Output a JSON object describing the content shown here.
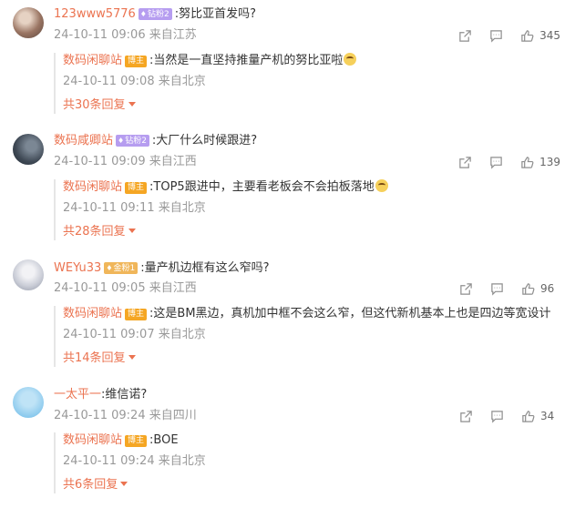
{
  "icons": {
    "share": "share-icon",
    "comment": "comment-icon",
    "like": "thumbs-up-icon"
  },
  "colors": {
    "username": "#eb7350",
    "meta": "#999999",
    "badge_purple": "#b69df0",
    "badge_gold": "#f0b65a",
    "author": "#f5a623"
  },
  "comments": [
    {
      "user": "123www5776",
      "badge": "钻粉2",
      "text": ":努比亚首发吗?",
      "time": "24-10-11 09:06",
      "location": "来自江苏",
      "likes": "345",
      "reply": {
        "user": "数码闲聊站",
        "badge": "博主",
        "text": ":当然是一直坚持推量产机的努比亚啦",
        "emoji": "laugh-emoji",
        "time": "24-10-11 09:08",
        "location": "来自北京",
        "more": "共30条回复"
      }
    },
    {
      "user": "数码咸卿站",
      "badge": "钻粉2",
      "text": ":大厂什么时候跟进?",
      "time": "24-10-11 09:09",
      "location": "来自江西",
      "likes": "139",
      "reply": {
        "user": "数码闲聊站",
        "badge": "博主",
        "text": ":TOP5跟进中，主要看老板会不会拍板落地",
        "emoji": "grin-emoji",
        "time": "24-10-11 09:11",
        "location": "来自北京",
        "more": "共28条回复"
      }
    },
    {
      "user": "WEYu33",
      "badge": "金粉1",
      "text": ":量产机边框有这么窄吗?",
      "time": "24-10-11 09:05",
      "location": "来自江西",
      "likes": "96",
      "reply": {
        "user": "数码闲聊站",
        "badge": "博主",
        "text": ":这是BM黑边，真机加中框不会这么窄，但这代新机基本上也是四边等宽设计",
        "time": "24-10-11 09:07",
        "location": "来自北京",
        "more": "共14条回复"
      }
    },
    {
      "user": "一太平一",
      "text": ":维信诺?",
      "time": "24-10-11 09:24",
      "location": "来自四川",
      "likes": "34",
      "reply": {
        "user": "数码闲聊站",
        "badge": "博主",
        "text": ":BOE",
        "time": "24-10-11 09:24",
        "location": "来自北京",
        "more": "共6条回复"
      }
    }
  ]
}
